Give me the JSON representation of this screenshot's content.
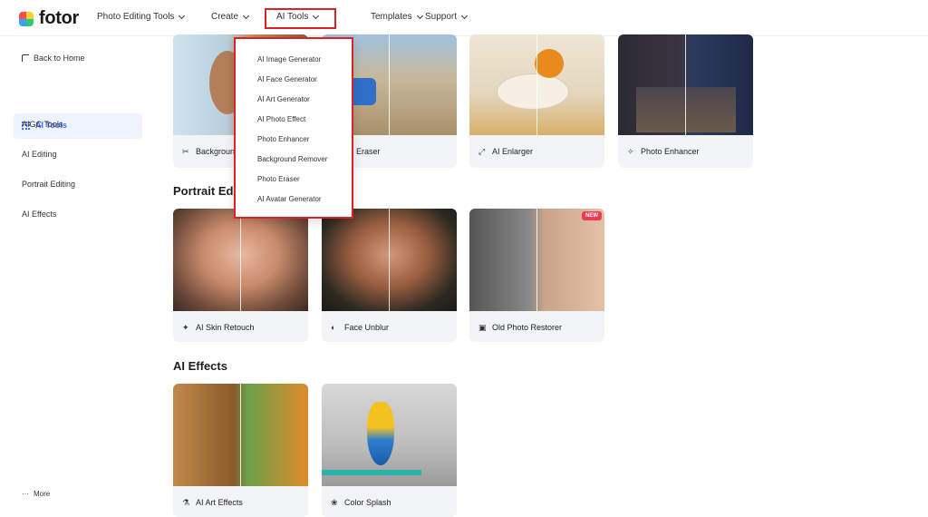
{
  "logo": {
    "text": "fotor",
    "colors": [
      "#ff4d4d",
      "#3aa0ff",
      "#ffcf2e",
      "#2ecc71"
    ]
  },
  "nav": {
    "items": [
      {
        "label": "Photo Editing Tools"
      },
      {
        "label": "Create"
      },
      {
        "label": "AI Tools"
      },
      {
        "label": "Templates"
      },
      {
        "label": "Support"
      }
    ],
    "active": "AI Tools"
  },
  "sidebar": {
    "back": "Back to Home",
    "active": "AI Tools",
    "items": [
      "AIGC Tools",
      "AI Editing",
      "Portrait Editing",
      "AI Effects"
    ],
    "more": "More"
  },
  "dropdown": {
    "items": [
      "AI Image Generator",
      "AI Face Generator",
      "AI Art Generator",
      "AI Photo Effect",
      "Photo Enhancer",
      "Background Remover",
      "Photo Eraser",
      "AI Avatar Generator"
    ]
  },
  "sections": {
    "top_cards": [
      "Background Remover",
      "Magic Eraser",
      "AI Enlarger",
      "Photo Enhancer"
    ],
    "top_cards_visible": [
      "Backgroun",
      "gic Eraser",
      "AI Enlarger",
      "Photo Enhancer"
    ],
    "portrait_title": "Portrait Edit",
    "portrait_cards": [
      "AI Skin Retouch",
      "Face Unblur",
      "Old Photo Restorer"
    ],
    "new_badge": "NEW",
    "effects_title": "AI Effects",
    "effects_cards": [
      "AI Art Effects",
      "Color Splash"
    ]
  },
  "colors": {
    "accent": "#3a6df0",
    "highlight": "#d8232a",
    "new_badge": "#ef3b5b"
  }
}
